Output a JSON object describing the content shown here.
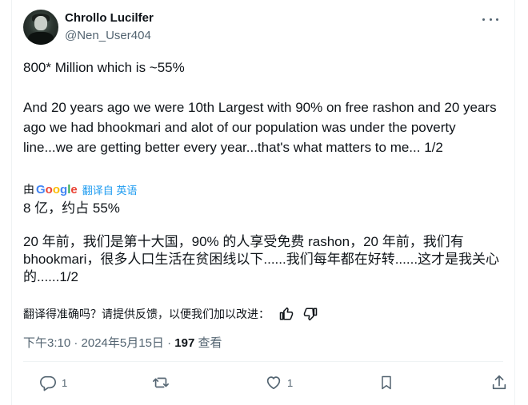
{
  "author": {
    "name": "Chrollo Lucilfer",
    "handle": "@Nen_User404"
  },
  "tweet": {
    "original_text": "800* Million which is ~55%\n\nAnd 20 years ago we were 10th Largest with 90% on free rashon and 20 years ago we had bhookmari and alot of our population was under the poverty line...we are getting better every year...that's what matters to me... 1/2",
    "translated_by_prefix": "由",
    "translation_provider": "Google",
    "translation_link": "翻译自 英语",
    "translated_line1": "8 亿，约占 55%",
    "translated_line2": "20 年前，我们是第十大国，90% 的人享受免费 rashon，20 年前，我们有 bhookmari，很多人口生活在贫困线以下......我们每年都在好转......这才是我关心的......1/2",
    "feedback_prompt": "翻译得准确吗？请提供反馈，以便我们加以改进：",
    "time": "下午3:10 · 2024年5月15日 · ",
    "views_count": "197",
    "views_label": " 查看"
  },
  "actions": {
    "reply_count": "1",
    "like_count": "1"
  },
  "colors": {
    "link": "#1d9bf0",
    "secondary": "#536471"
  },
  "icons": [
    "more-icon",
    "thumbs-up-icon",
    "thumbs-down-icon",
    "reply-icon",
    "retweet-icon",
    "like-icon",
    "bookmark-icon",
    "share-icon"
  ]
}
